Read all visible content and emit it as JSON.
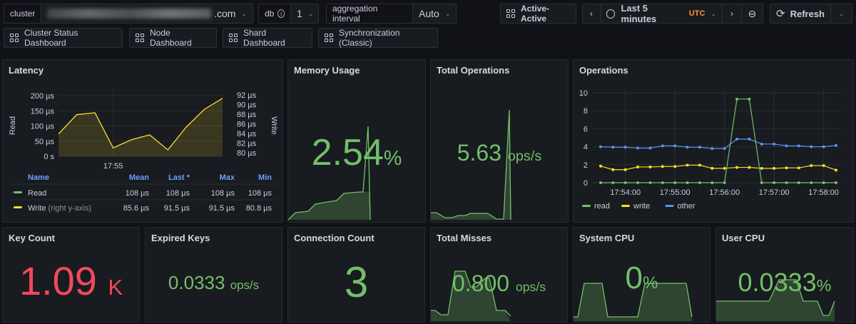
{
  "toolbar": {
    "cluster_label": "cluster",
    "cluster_value_suffix": ".com",
    "db_label": "db",
    "db_value": "1",
    "agg_label": "aggregation interval",
    "agg_value": "Auto",
    "active_active": "Active-Active",
    "time_range": "Last 5 minutes",
    "timezone": "UTC",
    "refresh": "Refresh"
  },
  "links": [
    "Cluster Status Dashboard",
    "Node Dashboard",
    "Shard Dashboard",
    "Synchronization (Classic)"
  ],
  "colors": {
    "green": "#73bf69",
    "yellow": "#fade2a",
    "blue": "#5794f2",
    "red": "#f2495c",
    "utc": "#ff9830"
  },
  "panels": {
    "latency": {
      "title": "Latency"
    },
    "memory": {
      "title": "Memory Usage",
      "value": "2.54",
      "unit": "%"
    },
    "total_ops": {
      "title": "Total Operations",
      "value": "5.63",
      "unit": "ops/s"
    },
    "operations": {
      "title": "Operations"
    },
    "key_count": {
      "title": "Key Count",
      "value": "1.09",
      "unit": "K"
    },
    "expired_keys": {
      "title": "Expired Keys",
      "value": "0.0333",
      "unit": "ops/s"
    },
    "connections": {
      "title": "Connection Count",
      "value": "3"
    },
    "misses": {
      "title": "Total Misses",
      "value": "0.800",
      "unit": "ops/s"
    },
    "sys_cpu": {
      "title": "System CPU",
      "value": "0",
      "unit": "%"
    },
    "user_cpu": {
      "title": "User CPU",
      "value": "0.0333",
      "unit": "%"
    }
  },
  "chart_data": [
    {
      "type": "line",
      "title": "Latency",
      "ylabel": "Read",
      "y2label": "Write",
      "yticks": [
        "0 s",
        "50 µs",
        "100 µs",
        "150 µs",
        "200 µs"
      ],
      "ylim": [
        0,
        200
      ],
      "y2ticks": [
        "80 µs",
        "82 µs",
        "84 µs",
        "86 µs",
        "88 µs",
        "90 µs",
        "92 µs"
      ],
      "y2lim": [
        80,
        92
      ],
      "xticks": [
        "17:55"
      ],
      "x": [
        "17:53:30",
        "17:54:00",
        "17:54:30",
        "17:55:00",
        "17:55:30",
        "17:56:00",
        "17:56:30",
        "17:57:00",
        "17:57:30",
        "17:58:00"
      ],
      "series": [
        {
          "name": "Write",
          "axis": "right",
          "values": [
            83.9,
            87.9,
            88.3,
            81.0,
            82.7,
            83.7,
            80.6,
            85.3,
            89.0,
            91.3
          ]
        }
      ],
      "legend": {
        "columns": [
          "Name",
          "Mean",
          "Last *",
          "Max",
          "Min"
        ],
        "rows": [
          {
            "name": "Read",
            "suffix": "",
            "mean": "108 µs",
            "last": "108 µs",
            "max": "108 µs",
            "min": "108 µs"
          },
          {
            "name": "Write",
            "suffix": "(right y-axis)",
            "mean": "85.6 µs",
            "last": "91.5 µs",
            "max": "91.5 µs",
            "min": "80.8 µs"
          }
        ]
      }
    },
    {
      "type": "line",
      "title": "Operations",
      "ylim": [
        0,
        10
      ],
      "yticks": [
        "0",
        "2",
        "4",
        "6",
        "8",
        "10"
      ],
      "xticks": [
        "17:54:00",
        "17:55:00",
        "17:56:00",
        "17:57:00",
        "17:58:00"
      ],
      "legend": "bottom-left",
      "x": [
        "17:53:30",
        "17:53:45",
        "17:54:00",
        "17:54:15",
        "17:54:30",
        "17:54:45",
        "17:55:00",
        "17:55:15",
        "17:55:30",
        "17:55:45",
        "17:56:00",
        "17:56:15",
        "17:56:30",
        "17:56:45",
        "17:57:00",
        "17:57:15",
        "17:57:30",
        "17:57:45",
        "17:58:00",
        "17:58:15"
      ],
      "series": [
        {
          "name": "read",
          "values": [
            0,
            0,
            0,
            0,
            0,
            0,
            0,
            0,
            0,
            0,
            0,
            9.3,
            9.3,
            0,
            0,
            0,
            0,
            0,
            0,
            0
          ]
        },
        {
          "name": "write",
          "values": [
            1.85,
            1.45,
            1.45,
            1.75,
            1.75,
            1.8,
            1.8,
            1.95,
            1.95,
            1.6,
            1.6,
            1.7,
            1.7,
            1.6,
            1.6,
            1.65,
            1.65,
            1.9,
            1.9,
            1.4
          ]
        },
        {
          "name": "other",
          "values": [
            4.0,
            3.95,
            3.95,
            3.85,
            3.85,
            4.1,
            4.1,
            3.95,
            3.95,
            3.8,
            3.8,
            4.85,
            4.85,
            4.3,
            4.3,
            4.1,
            4.1,
            4.0,
            4.0,
            4.15
          ]
        }
      ]
    }
  ]
}
